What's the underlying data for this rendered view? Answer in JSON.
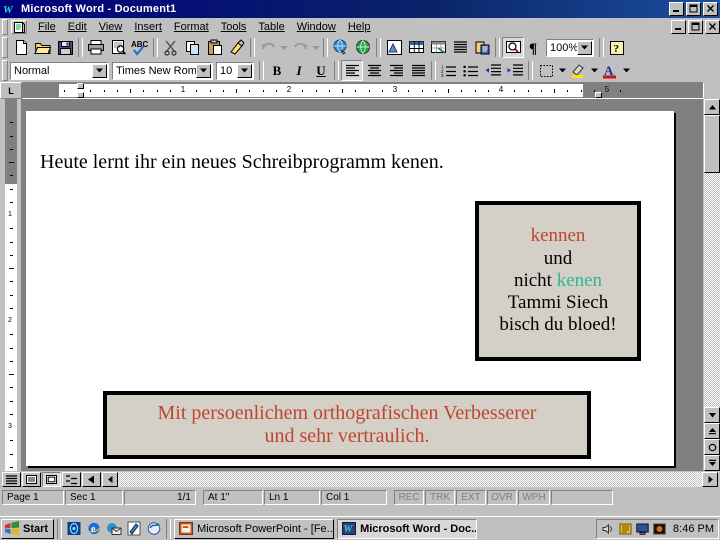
{
  "app": {
    "window_title": "Microsoft Word - Document1",
    "app_icon": "word-w-icon",
    "titlebar_buttons": {
      "minimize": "_",
      "restore": "❐",
      "close": "✕"
    },
    "doc_titlebar_buttons": {
      "minimize": "_",
      "restore": "❐",
      "close": "✕"
    }
  },
  "menu": {
    "doc_control_icon": "document-control-icon",
    "items": [
      {
        "label": "File"
      },
      {
        "label": "Edit"
      },
      {
        "label": "View"
      },
      {
        "label": "Insert"
      },
      {
        "label": "Format"
      },
      {
        "label": "Tools"
      },
      {
        "label": "Table"
      },
      {
        "label": "Window"
      },
      {
        "label": "Help"
      }
    ]
  },
  "standard_toolbar": {
    "buttons": [
      {
        "name": "new-document-icon",
        "tip": "New"
      },
      {
        "name": "open-folder-icon",
        "tip": "Open"
      },
      {
        "name": "save-disk-icon",
        "tip": "Save"
      },
      {
        "name": "print-icon",
        "tip": "Print"
      },
      {
        "name": "print-preview-icon",
        "tip": "Print Preview"
      },
      {
        "name": "spelling-check-icon",
        "tip": "Spelling and Grammar"
      },
      {
        "name": "cut-scissors-icon",
        "tip": "Cut"
      },
      {
        "name": "copy-icon",
        "tip": "Copy"
      },
      {
        "name": "paste-clipboard-icon",
        "tip": "Paste"
      },
      {
        "name": "format-painter-icon",
        "tip": "Format Painter"
      },
      {
        "name": "undo-icon",
        "tip": "Undo"
      },
      {
        "name": "redo-icon",
        "tip": "Redo"
      },
      {
        "name": "insert-hyperlink-icon",
        "tip": "Insert Hyperlink"
      },
      {
        "name": "web-toolbar-icon",
        "tip": "Web Toolbar"
      },
      {
        "name": "drawing-icon",
        "tip": "Drawing"
      },
      {
        "name": "insert-table-icon",
        "tip": "Insert Table"
      },
      {
        "name": "insert-excel-worksheet-icon",
        "tip": "Insert Microsoft Excel Worksheet"
      },
      {
        "name": "columns-icon",
        "tip": "Columns"
      },
      {
        "name": "document-map-icon",
        "tip": "Document Map"
      },
      {
        "name": "zoom-magnifier-icon",
        "tip": "Zoom"
      },
      {
        "name": "show-formatting-marks-icon",
        "tip": "Show/Hide ¶"
      },
      {
        "name": "office-assistant-icon",
        "tip": "Office Assistant"
      }
    ],
    "zoom_value": "100%"
  },
  "formatting_toolbar": {
    "style_value": "Normal",
    "font_value": "Times New Roman",
    "size_value": "10",
    "bold_label": "B",
    "italic_label": "I",
    "underline_label": "U",
    "buttons": [
      {
        "name": "align-left-icon"
      },
      {
        "name": "align-center-icon"
      },
      {
        "name": "align-right-icon"
      },
      {
        "name": "justify-icon"
      },
      {
        "name": "numbered-list-icon"
      },
      {
        "name": "bulleted-list-icon"
      },
      {
        "name": "decrease-indent-icon"
      },
      {
        "name": "increase-indent-icon"
      },
      {
        "name": "borders-icon"
      },
      {
        "name": "highlight-icon"
      },
      {
        "name": "font-color-icon"
      }
    ]
  },
  "ruler": {
    "horizontal_labels": [
      "1",
      "2",
      "3",
      "4",
      "5"
    ],
    "vertical_labels": [
      "1",
      "2",
      "3"
    ],
    "corner_label": "L"
  },
  "document": {
    "body_line": "Heute lernt ihr ein neues Schreibprogramm kenen.",
    "text_box_right": {
      "lines": [
        {
          "text": "kennen",
          "color": "#c0452f"
        },
        {
          "text": "und",
          "color": "#000000"
        },
        {
          "text": "nicht ",
          "color": "#000000",
          "suffix": "kenen",
          "suffix_color": "#2eb898"
        },
        {
          "text": "Tammi Siech",
          "color": "#000000"
        },
        {
          "text": "bisch du bloed!",
          "color": "#000000"
        }
      ]
    },
    "text_box_bottom": {
      "line1": "Mit persoenlichem orthografischen Verbesserer",
      "line2": "und sehr vertraulich.",
      "color": "#c0452f"
    }
  },
  "view_buttons": [
    {
      "name": "normal-view-button"
    },
    {
      "name": "online-layout-view-button"
    },
    {
      "name": "page-layout-view-button"
    },
    {
      "name": "outline-view-button"
    },
    {
      "name": "master-document-view-button"
    }
  ],
  "scroll": {
    "up_arrow": "▲",
    "down_arrow": "▼",
    "left_arrow": "◄",
    "right_arrow": "►",
    "prev_page": "▲",
    "select_browse_object": "●",
    "next_page": "▼"
  },
  "statusbar": {
    "page": "Page 1",
    "section": "Sec 1",
    "pages": "1/1",
    "at": "At 1\"",
    "line": "Ln 1",
    "column": "Col 1",
    "indicators": [
      "REC",
      "TRK",
      "EXT",
      "OVR",
      "WPH"
    ]
  },
  "taskbar": {
    "start_label": "Start",
    "start_icon": "windows-flag-icon",
    "quick_launch": [
      {
        "name": "channel-viewer-icon"
      },
      {
        "name": "internet-explorer-icon"
      },
      {
        "name": "outlook-express-icon"
      },
      {
        "name": "show-desktop-icon"
      },
      {
        "name": "media-player-icon"
      }
    ],
    "tasks": [
      {
        "label": "Microsoft PowerPoint - [Fe...",
        "icon": "powerpoint-icon",
        "active": false
      },
      {
        "label": "Microsoft Word - Doc...",
        "icon": "word-icon",
        "active": true
      }
    ],
    "tray": [
      {
        "name": "volume-speaker-icon"
      },
      {
        "name": "task-scheduler-icon"
      },
      {
        "name": "display-icon"
      },
      {
        "name": "monitor-icon"
      }
    ],
    "clock": "8:46 PM"
  }
}
